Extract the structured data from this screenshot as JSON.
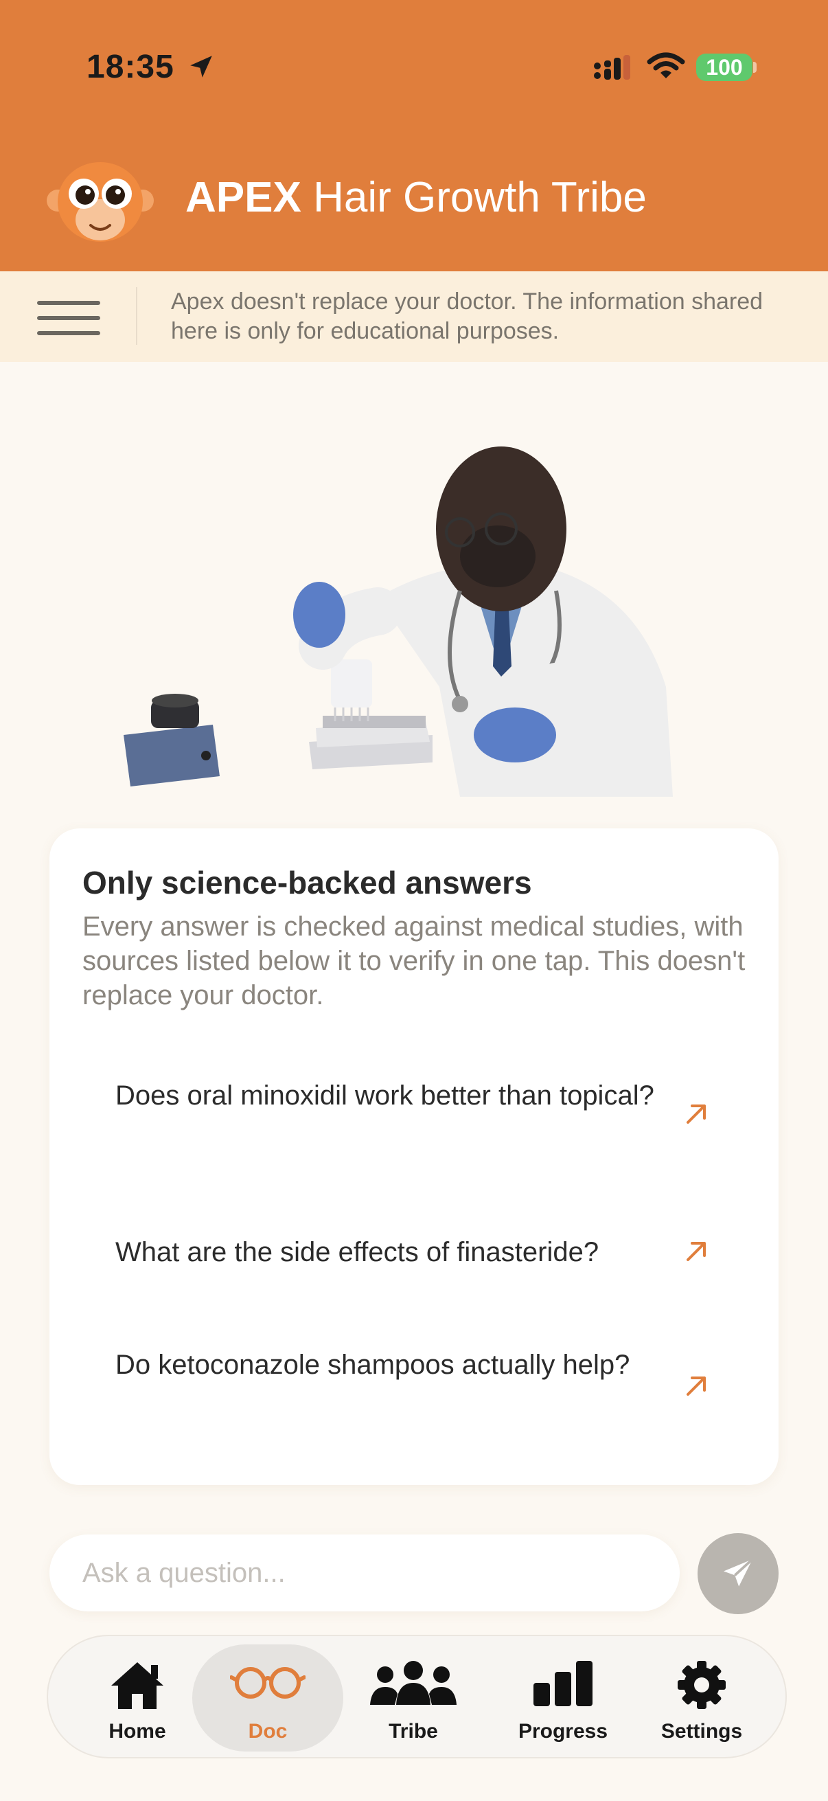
{
  "status_bar": {
    "time": "18:35",
    "battery": "100"
  },
  "header": {
    "brand": "APEX",
    "title": "Hair Growth Tribe"
  },
  "disclaimer": "Apex doesn't replace your doctor. The information shared here is only for educational purposes.",
  "card": {
    "title": "Only science-backed answers",
    "subtitle": "Every answer is checked against medical studies, with sources listed below it to verify in one tap. This doesn't replace your doctor.",
    "questions": [
      "Does oral minoxidil work better than topical?",
      "What are the side effects of finasteride?",
      "Do ketoconazole shampoos actually help?"
    ]
  },
  "ask": {
    "placeholder": "Ask a question..."
  },
  "nav": {
    "items": [
      {
        "label": "Home",
        "icon": "home-icon"
      },
      {
        "label": "Doc",
        "icon": "glasses-icon",
        "active": true
      },
      {
        "label": "Tribe",
        "icon": "people-icon"
      },
      {
        "label": "Progress",
        "icon": "bar-chart-icon"
      },
      {
        "label": "Settings",
        "icon": "gear-icon"
      }
    ]
  },
  "colors": {
    "accent": "#e07e3c",
    "background": "#fcf8f2",
    "disclaimer_bg": "#fbefdc",
    "battery": "#5fc96d"
  }
}
